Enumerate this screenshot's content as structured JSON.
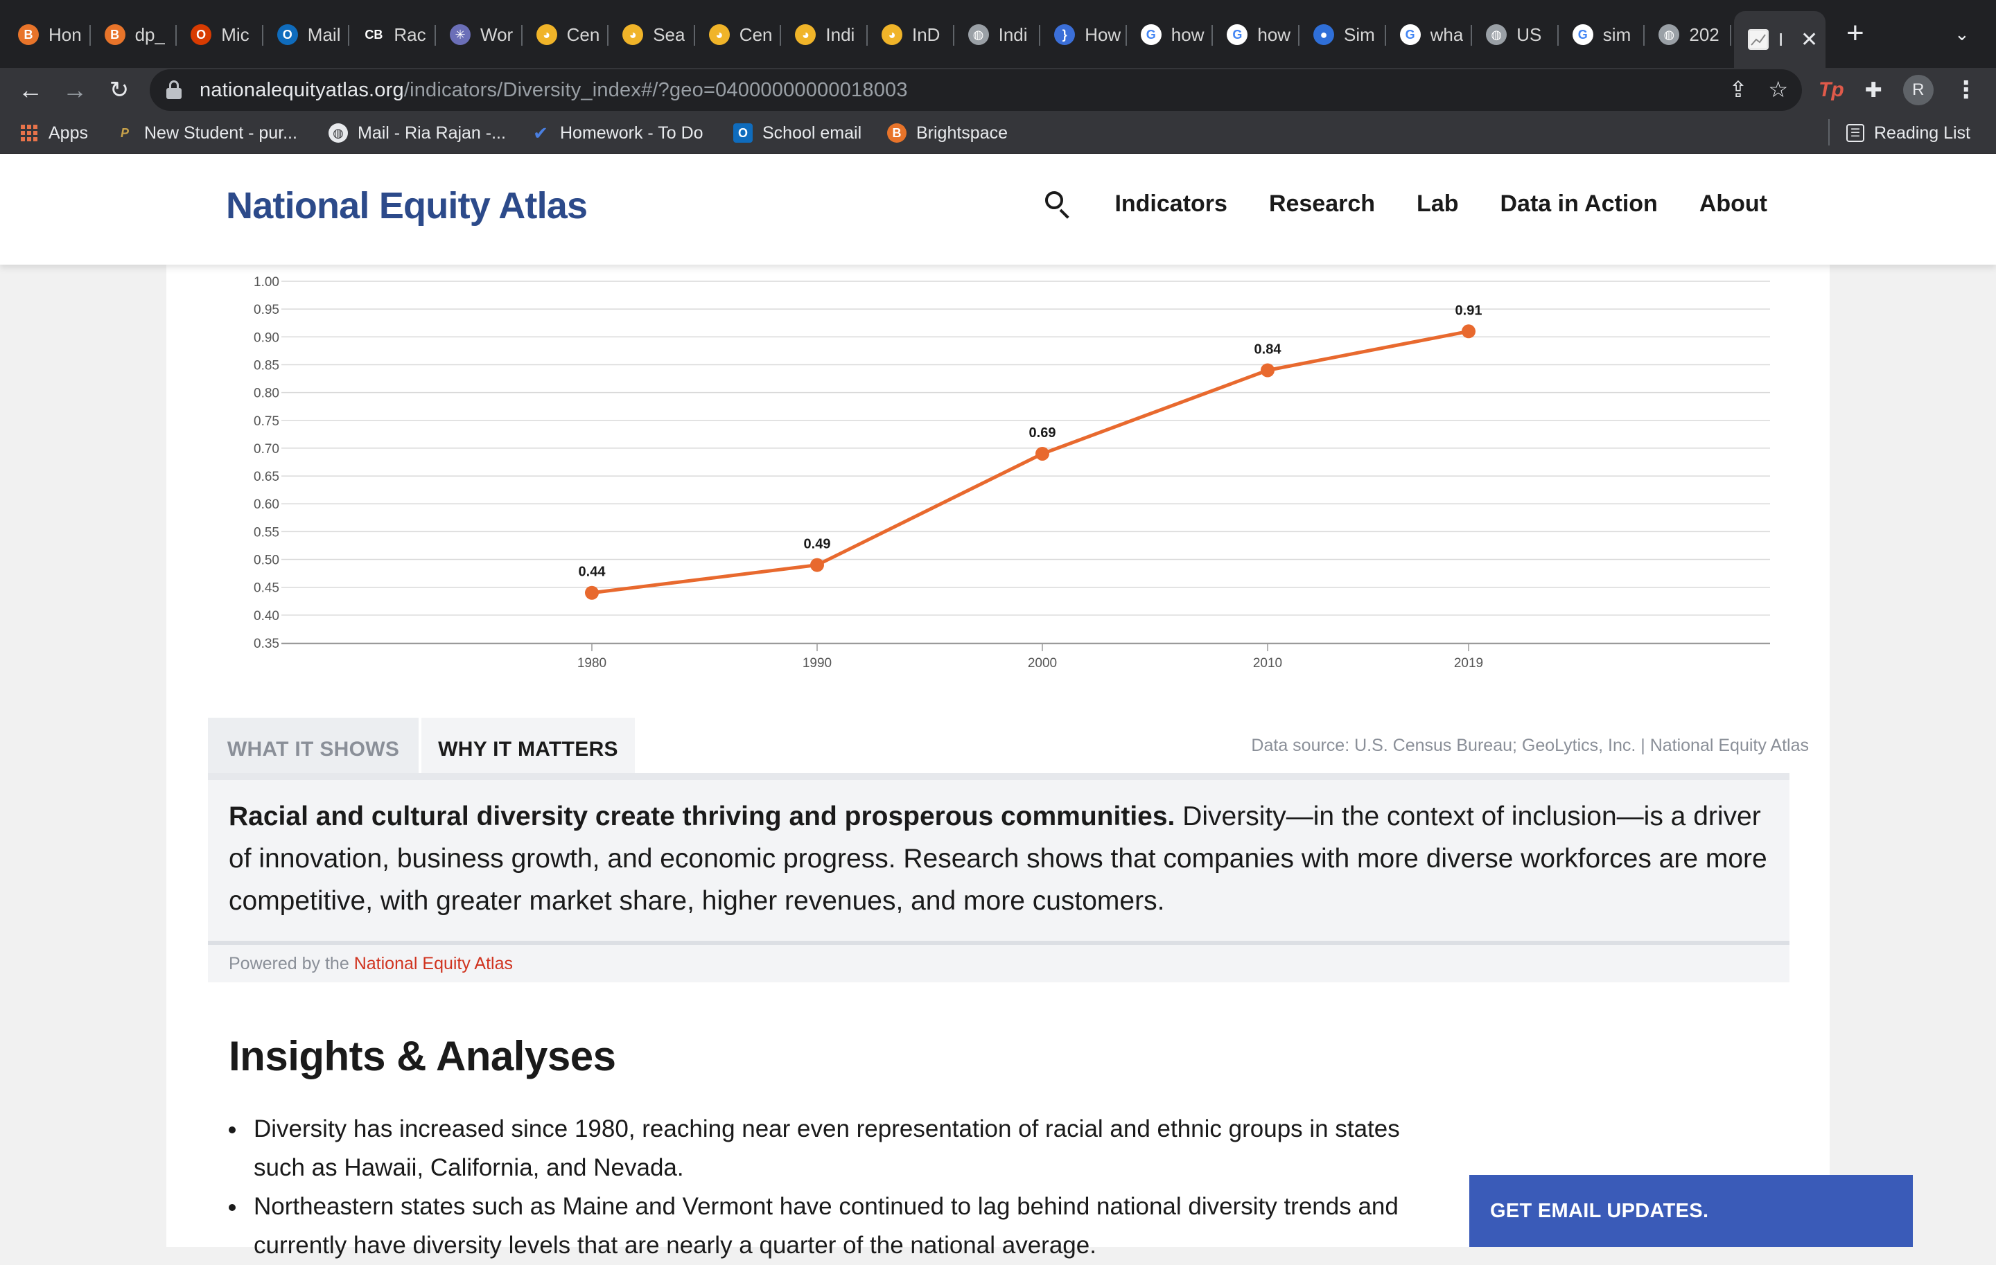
{
  "browser": {
    "tabs": [
      {
        "title": "Hon",
        "icon": "brightspace-icon",
        "color": "#e8742a",
        "glyph": "B"
      },
      {
        "title": "dp_",
        "icon": "brightspace-icon",
        "color": "#e8742a",
        "glyph": "B"
      },
      {
        "title": "Mic",
        "icon": "office-icon",
        "color": "#d83b01",
        "glyph": "O"
      },
      {
        "title": "Mail",
        "icon": "outlook-icon",
        "color": "#0f6cbd",
        "glyph": "O"
      },
      {
        "title": "Rac",
        "icon": "cb-icon",
        "color": "#202124",
        "glyph": "CB"
      },
      {
        "title": "Wor",
        "icon": "sparkle-icon",
        "color": "#6b6fb8",
        "glyph": "✳"
      },
      {
        "title": "Cen",
        "icon": "census-icon",
        "color": "#f0b429",
        "glyph": "◕"
      },
      {
        "title": "Sea",
        "icon": "census-icon",
        "color": "#f0b429",
        "glyph": "◕"
      },
      {
        "title": "Cen",
        "icon": "census-icon",
        "color": "#f0b429",
        "glyph": "◕"
      },
      {
        "title": "Indi",
        "icon": "census-icon",
        "color": "#f0b429",
        "glyph": "◕"
      },
      {
        "title": "InD",
        "icon": "census-icon",
        "color": "#f0b429",
        "glyph": "◕"
      },
      {
        "title": "Indi",
        "icon": "globe-icon",
        "color": "#9aa0a6",
        "glyph": "◍"
      },
      {
        "title": "How",
        "icon": "bracket-icon",
        "color": "#3b6fd8",
        "glyph": "}"
      },
      {
        "title": "how",
        "icon": "google-icon",
        "color": "#ffffff",
        "glyph": "G"
      },
      {
        "title": "how",
        "icon": "google-icon",
        "color": "#ffffff",
        "glyph": "G"
      },
      {
        "title": "Sim",
        "icon": "simplilearn-icon",
        "color": "#2f6fd8",
        "glyph": "●"
      },
      {
        "title": "wha",
        "icon": "google-icon",
        "color": "#ffffff",
        "glyph": "G"
      },
      {
        "title": "US",
        "icon": "globe-icon",
        "color": "#9aa0a6",
        "glyph": "◍"
      },
      {
        "title": "sim",
        "icon": "google-icon",
        "color": "#ffffff",
        "glyph": "G"
      },
      {
        "title": "202",
        "icon": "globe-icon",
        "color": "#9aa0a6",
        "glyph": "◍"
      }
    ],
    "active_tab": {
      "title": "I",
      "close": "✕"
    },
    "new_tab": "+",
    "url_host": "nationalequityatlas.org",
    "url_path": "/indicators/Diversity_index#/?geo=04000000000018003",
    "profile_initial": "R",
    "bookmarks": [
      {
        "label": "Apps",
        "icon": "apps-grid-icon"
      },
      {
        "label": "New Student - pur...",
        "icon": "purdue-icon"
      },
      {
        "label": "Mail - Ria Rajan -...",
        "icon": "globe-icon"
      },
      {
        "label": "Homework - To Do",
        "icon": "check-icon"
      },
      {
        "label": "School email",
        "icon": "outlook-icon"
      },
      {
        "label": "Brightspace",
        "icon": "brightspace-icon"
      }
    ],
    "reading_list": "Reading List"
  },
  "site": {
    "logo": "National Equity Atlas",
    "nav": [
      "Indicators",
      "Research",
      "Lab",
      "Data in Action",
      "About"
    ]
  },
  "chart_data": {
    "type": "line",
    "x": [
      "1980",
      "1990",
      "2000",
      "2010",
      "2019"
    ],
    "values": [
      0.44,
      0.49,
      0.69,
      0.84,
      0.91
    ],
    "data_labels": [
      "0.44",
      "0.49",
      "0.69",
      "0.84",
      "0.91"
    ],
    "y_ticks": [
      "1.00",
      "0.95",
      "0.90",
      "0.85",
      "0.80",
      "0.75",
      "0.70",
      "0.65",
      "0.60",
      "0.55",
      "0.50",
      "0.45",
      "0.40",
      "0.35"
    ],
    "ylim": [
      0.35,
      1.0
    ],
    "grid": true,
    "line_color": "#e8692e"
  },
  "info_tabs": {
    "what": "WHAT IT SHOWS",
    "why": "WHY IT MATTERS",
    "selected": "WHY IT MATTERS"
  },
  "data_source": "Data source: U.S. Census Bureau; GeoLytics, Inc. | National Equity Atlas",
  "why_panel": {
    "bold": "Racial and cultural diversity create thriving and prosperous communities.",
    "body": " Diversity—in the context of inclusion—is a driver of innovation, business growth, and economic progress. Research shows that companies with more diverse workforces are more competitive, with greater market share, higher revenues, and more customers."
  },
  "powered_by": {
    "prefix": "Powered by the",
    "link": "National Equity Atlas"
  },
  "insights": {
    "title": "Insights & Analyses",
    "items": [
      "Diversity has increased since 1980, reaching near even representation of racial and ethnic groups in states such as Hawaii, California, and Nevada.",
      "Northeastern states such as Maine and Vermont have continued to lag behind national diversity trends and currently have diversity levels that are nearly a quarter of the national average."
    ]
  },
  "email_cta": "GET EMAIL UPDATES."
}
